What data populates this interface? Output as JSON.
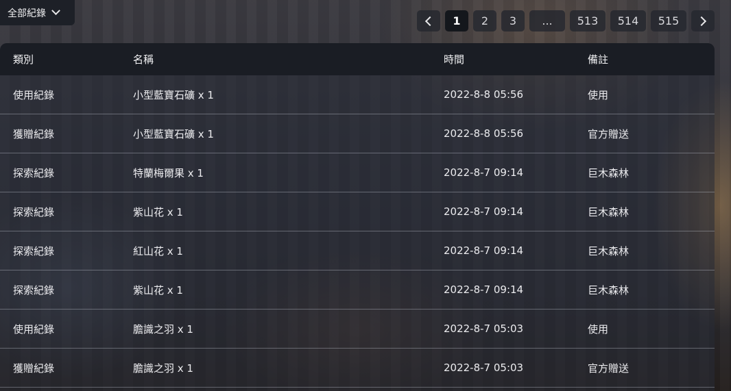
{
  "filter": {
    "label": "全部紀錄",
    "icon": "chevron-down-icon"
  },
  "pagination": {
    "prev_icon": "chevron-left-icon",
    "next_icon": "chevron-right-icon",
    "current_page": 1,
    "pages": [
      "1",
      "2",
      "3",
      "...",
      "513",
      "514",
      "515"
    ]
  },
  "table": {
    "headers": {
      "category": "類別",
      "name": "名稱",
      "time": "時間",
      "note": "備註"
    },
    "rows": [
      {
        "category": "使用紀錄",
        "name": "小型藍寶石礦 x 1",
        "time": "2022-8-8 05:56",
        "note": "使用"
      },
      {
        "category": "獲贈紀錄",
        "name": "小型藍寶石礦 x 1",
        "time": "2022-8-8 05:56",
        "note": "官方贈送"
      },
      {
        "category": "探索紀錄",
        "name": "特蘭梅爾果 x 1",
        "time": "2022-8-7 09:14",
        "note": "巨木森林"
      },
      {
        "category": "探索紀錄",
        "name": "紫山花 x 1",
        "time": "2022-8-7 09:14",
        "note": "巨木森林"
      },
      {
        "category": "探索紀錄",
        "name": "紅山花 x 1",
        "time": "2022-8-7 09:14",
        "note": "巨木森林"
      },
      {
        "category": "探索紀錄",
        "name": "紫山花 x 1",
        "time": "2022-8-7 09:14",
        "note": "巨木森林"
      },
      {
        "category": "使用紀錄",
        "name": "膽識之羽 x 1",
        "time": "2022-8-7 05:03",
        "note": "使用"
      },
      {
        "category": "獲贈紀錄",
        "name": "膽識之羽 x 1",
        "time": "2022-8-7 05:03",
        "note": "官方贈送"
      }
    ]
  }
}
